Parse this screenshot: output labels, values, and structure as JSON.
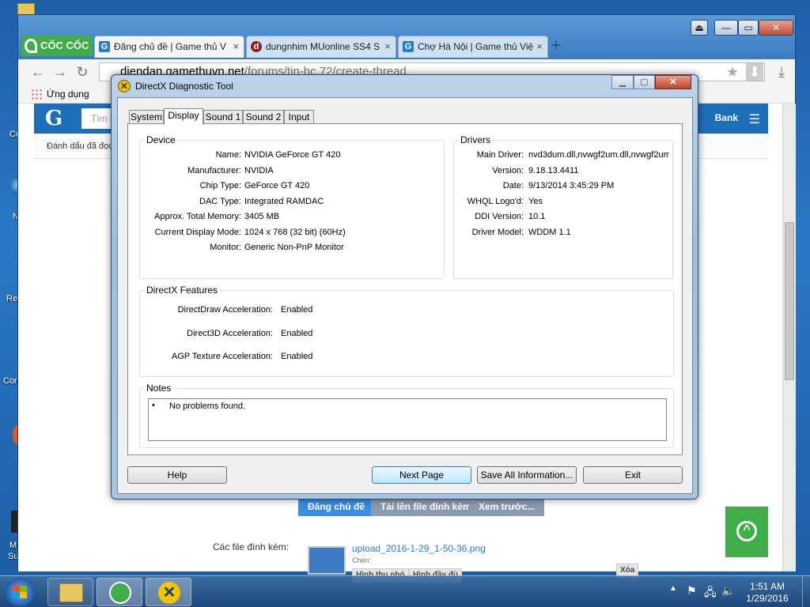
{
  "browser": {
    "brand": "CỐC CỐC",
    "tabs": [
      {
        "title": "Đăng chủ đề | Game thủ V",
        "favicon": "G"
      },
      {
        "title": "dungnhim MUonline SS4 S",
        "favicon": "d"
      },
      {
        "title": "Chợ Hà Nội | Game thủ Việ",
        "favicon": "G"
      }
    ],
    "new_tab": "+",
    "url_host": "diendan.gamethuvn.net",
    "url_path": "/forums/tin-hc.72/create-thread",
    "bookmarks_apps": "Ứng dụng",
    "window_controls": {
      "minimize": "—",
      "maximize": "▭",
      "close": "✕"
    }
  },
  "page": {
    "logo": "G",
    "search_placeholder": "Tìm k",
    "bank": "Bank",
    "subnav": "Đánh dấu đã đọc",
    "buttons": [
      "Đăng chủ đề",
      "Tải lên file đính kèm",
      "Xem trước..."
    ],
    "attachments_label": "Các file đính kèm:",
    "attachment_file": "upload_2016-1-29_1-50-36.png",
    "attachment_insert": "Chèn:",
    "thumb_btn": "Hình thu nhỏ",
    "full_btn": "Hình đầy đủ",
    "delete_btn": "Xóa"
  },
  "desktop": {
    "labels": [
      "Co",
      "N",
      "Re",
      "Cor",
      "M",
      "Su"
    ]
  },
  "dxdiag": {
    "title": "DirectX Diagnostic Tool",
    "tabs": [
      "System",
      "Display",
      "Sound 1",
      "Sound 2",
      "Input"
    ],
    "active_tab": "Display",
    "device": {
      "label": "Device",
      "rows": [
        {
          "k": "Name:",
          "v": "NVIDIA GeForce GT 420"
        },
        {
          "k": "Manufacturer:",
          "v": "NVIDIA"
        },
        {
          "k": "Chip Type:",
          "v": "GeForce GT 420"
        },
        {
          "k": "DAC Type:",
          "v": "Integrated RAMDAC"
        },
        {
          "k": "Approx. Total Memory:",
          "v": "3405 MB"
        },
        {
          "k": "Current Display Mode:",
          "v": "1024 x 768 (32 bit) (60Hz)"
        },
        {
          "k": "Monitor:",
          "v": "Generic Non-PnP Monitor"
        }
      ]
    },
    "drivers": {
      "label": "Drivers",
      "rows": [
        {
          "k": "Main Driver:",
          "v": "nvd3dum.dll,nvwgf2um.dll,nvwgf2um"
        },
        {
          "k": "Version:",
          "v": "9.18.13.4411"
        },
        {
          "k": "Date:",
          "v": "9/13/2014 3:45:29 PM"
        },
        {
          "k": "WHQL Logo'd:",
          "v": "Yes"
        },
        {
          "k": "DDI Version:",
          "v": "10.1"
        },
        {
          "k": "Driver Model:",
          "v": "WDDM 1.1"
        }
      ]
    },
    "features": {
      "label": "DirectX Features",
      "rows": [
        {
          "k": "DirectDraw Acceleration:",
          "v": "Enabled"
        },
        {
          "k": "Direct3D Acceleration:",
          "v": "Enabled"
        },
        {
          "k": "AGP Texture Acceleration:",
          "v": "Enabled"
        }
      ]
    },
    "notes": {
      "label": "Notes",
      "items": [
        "No problems found."
      ]
    },
    "buttons": {
      "help": "Help",
      "next": "Next Page",
      "save": "Save All Information...",
      "exit": "Exit"
    }
  },
  "taskbar": {
    "time": "1:51 AM",
    "date": "1/29/2016"
  }
}
